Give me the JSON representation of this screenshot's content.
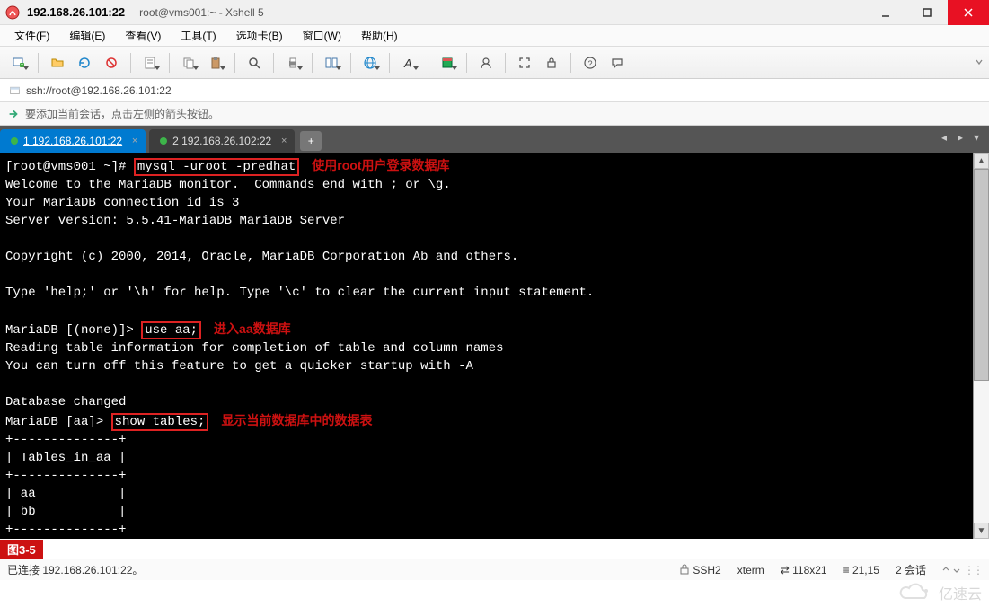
{
  "title": {
    "ip": "192.168.26.101:22",
    "session": "root@vms001:~ - Xshell 5"
  },
  "menu": {
    "file": "文件(F)",
    "edit": "编辑(E)",
    "view": "查看(V)",
    "tools": "工具(T)",
    "tabs": "选项卡(B)",
    "window": "窗口(W)",
    "help": "帮助(H)"
  },
  "addr": {
    "url": "ssh://root@192.168.26.101:22"
  },
  "info": {
    "hint": "要添加当前会话，点击左侧的箭头按钮。"
  },
  "tabs": {
    "t1": "1 192.168.26.101:22",
    "t2": "2 192.168.26.102:22",
    "add": "+"
  },
  "terminal": {
    "l1_prompt": "[root@vms001 ~]# ",
    "l1_cmd": "mysql -uroot -predhat",
    "l1_note": "使用root用户登录数据库",
    "l2": "Welcome to the MariaDB monitor.  Commands end with ; or \\g.",
    "l3": "Your MariaDB connection id is 3",
    "l4": "Server version: 5.5.41-MariaDB MariaDB Server",
    "l5": "",
    "l6": "Copyright (c) 2000, 2014, Oracle, MariaDB Corporation Ab and others.",
    "l7": "",
    "l8": "Type 'help;' or '\\h' for help. Type '\\c' to clear the current input statement.",
    "l9": "",
    "l10_prompt": "MariaDB [(none)]> ",
    "l10_cmd": "use aa;",
    "l10_note": "进入aa数据库",
    "l11": "Reading table information for completion of table and column names",
    "l12": "You can turn off this feature to get a quicker startup with -A",
    "l13": "",
    "l14": "Database changed",
    "l15_prompt": "MariaDB [aa]> ",
    "l15_cmd": "show tables;",
    "l15_note": "显示当前数据库中的数据表",
    "l16": "+--------------+",
    "l17": "| Tables_in_aa |",
    "l18": "+--------------+",
    "l19": "| aa           |",
    "l20": "| bb           |",
    "l21": "+--------------+"
  },
  "figure": {
    "label": "图3-5"
  },
  "status": {
    "left": "已连接 192.168.26.101:22。",
    "proto": "SSH2",
    "term": "xterm",
    "size": "118x21",
    "pos": "21,15",
    "sessions": "2 会话"
  },
  "watermark": {
    "text": "亿速云"
  }
}
